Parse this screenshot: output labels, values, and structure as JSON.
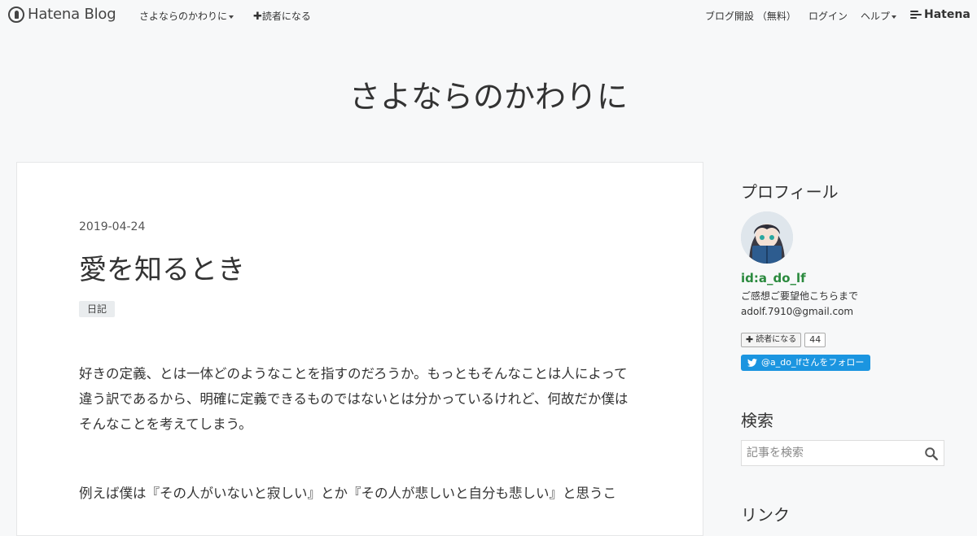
{
  "topbar": {
    "logo_text": "Hatena Blog",
    "blog_menu": "さよならのかわりに",
    "subscribe": "読者になる",
    "open_blog": "ブログ開設 （無料）",
    "login": "ログイン",
    "help": "ヘルプ",
    "brand": "Hatena"
  },
  "blog": {
    "title": "さよならのかわりに"
  },
  "post": {
    "date": "2019-04-24",
    "title": "愛を知るとき",
    "category": "日記",
    "paragraph1": "好きの定義、とは一体どのようなことを指すのだろうか。もっともそんなことは人によって違う訳であるから、明確に定義できるものではないとは分かっているけれど、何故だか僕はそんなことを考えてしまう。",
    "paragraph2": "例えば僕は『その人がいないと寂しい』とか『その人が悲しいと自分も悲しい』と思うこ"
  },
  "sidebar": {
    "profile_heading": "プロフィール",
    "profile_id": "id:a_do_lf",
    "profile_line1": "ご感想ご要望他こちらまで",
    "profile_line2": "adolf.7910@gmail.com",
    "subscribe_label": "読者になる",
    "subscriber_count": "44",
    "twitter_follow": "@a_do_lfさんをフォロー",
    "search_heading": "検索",
    "search_placeholder": "記事を検索",
    "links_heading": "リンク"
  },
  "colors": {
    "background": "#f7f8f9",
    "card": "#ffffff",
    "profile_id": "#2b8a3e",
    "twitter": "#1b95e0"
  }
}
